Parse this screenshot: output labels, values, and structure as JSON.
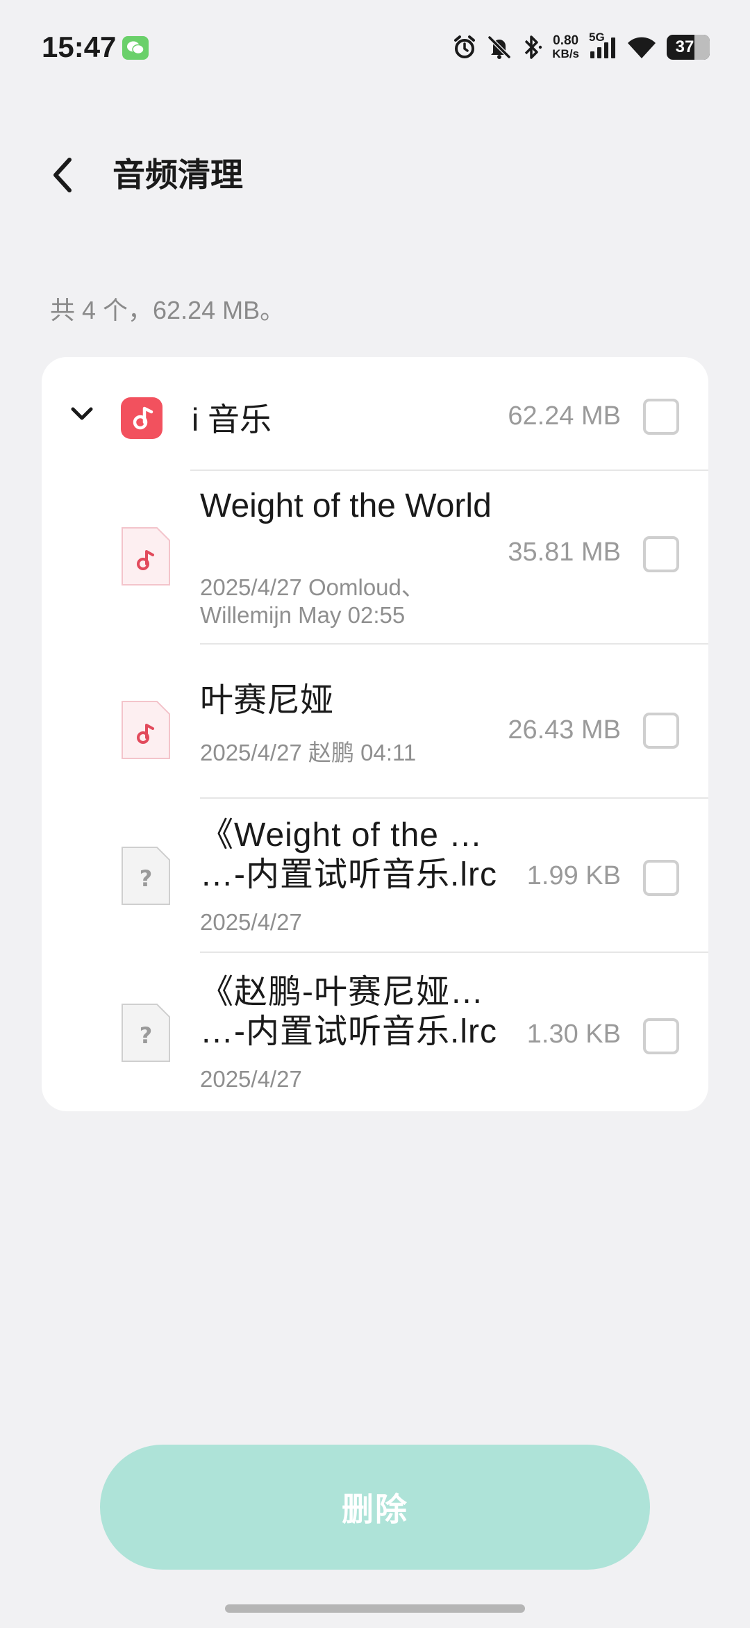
{
  "status_bar": {
    "time": "15:47",
    "net_speed_value": "0.80",
    "net_speed_unit": "KB/s",
    "network": "5G",
    "battery": "37",
    "icons": [
      "wechat-icon",
      "alarm-icon",
      "mute-icon",
      "bluetooth-icon",
      "signal-icon",
      "wifi-icon",
      "battery-icon"
    ]
  },
  "header": {
    "title": "音频清理"
  },
  "summary": "共 4 个，62.24 MB。",
  "group": {
    "name": "i 音乐",
    "size": "62.24 MB",
    "icon": "music-app-icon",
    "accent": "#f2515e",
    "items": [
      {
        "title": "Weight of the World",
        "subtitle": "2025/4/27 Oomloud、Willemijn May 02:55",
        "size": "35.81 MB",
        "type": "audio"
      },
      {
        "title": "叶赛尼娅",
        "subtitle": "2025/4/27 赵鹏 04:11",
        "size": "26.43 MB",
        "type": "audio"
      },
      {
        "title": "《Weight of the …\n…-内置试听音乐.lrc",
        "subtitle": "2025/4/27",
        "size": "1.99 KB",
        "type": "unknown"
      },
      {
        "title": "《赵鹏-叶赛尼娅…\n…-内置试听音乐.lrc",
        "subtitle": "2025/4/27",
        "size": "1.30 KB",
        "type": "unknown"
      }
    ]
  },
  "actions": {
    "delete_label": "删除",
    "delete_color": "#aee3d8"
  }
}
